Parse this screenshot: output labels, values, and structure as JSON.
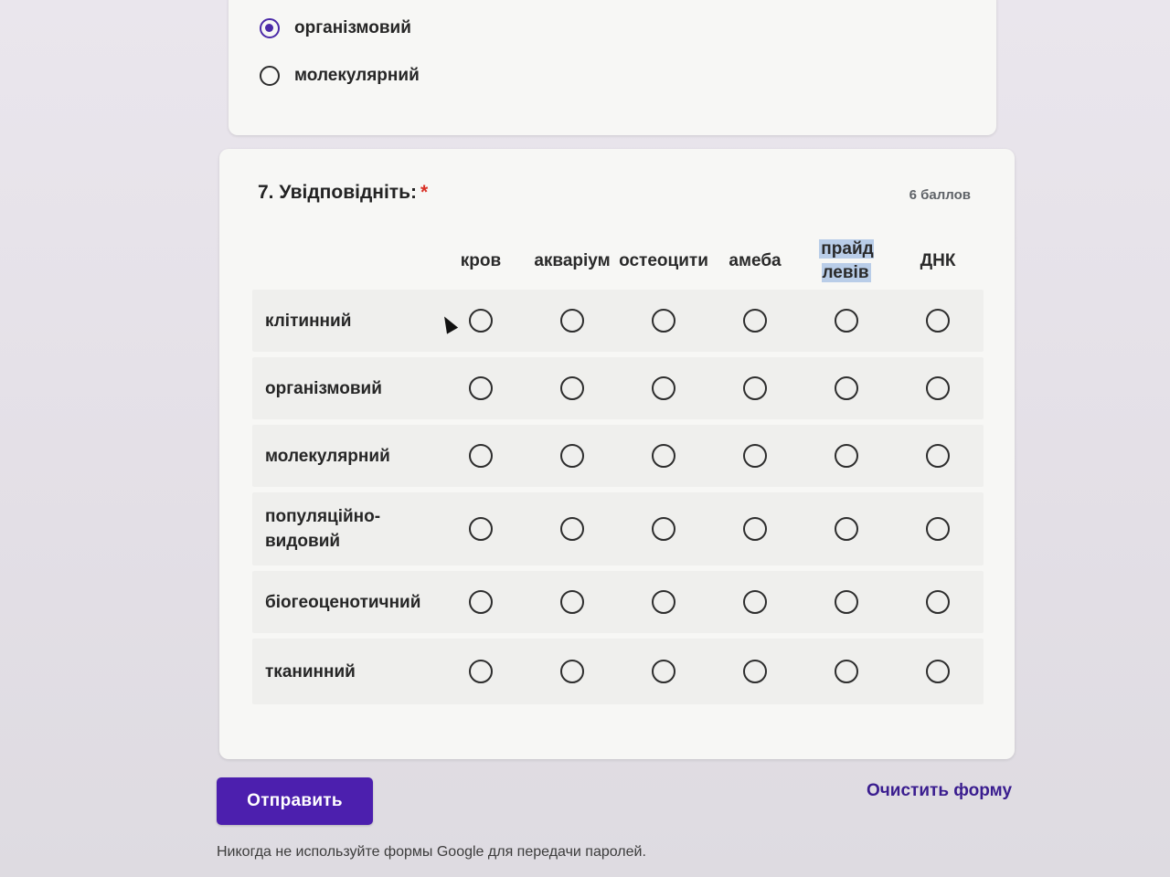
{
  "previous_question": {
    "options": [
      {
        "label": "організмовий",
        "checked": true
      },
      {
        "label": "молекулярний",
        "checked": false
      }
    ]
  },
  "question7": {
    "title": "7. Увідповідніть:",
    "required_mark": "*",
    "points": "6 баллов",
    "columns": [
      "кров",
      "акваріум",
      "остеоцити",
      "амеба",
      "прайд левів",
      "ДНК"
    ],
    "rows": [
      "клітинний",
      "організмовий",
      "молекулярний",
      "популяційно-видовий",
      "біогеоценотичний",
      "тканинний"
    ]
  },
  "actions": {
    "submit_label": "Отправить",
    "clear_label": "Очистить форму"
  },
  "footer": {
    "note": "Никогда не используйте формы Google для передачи паролей."
  },
  "colors": {
    "accent": "#4c1fae",
    "required": "#d93025"
  }
}
